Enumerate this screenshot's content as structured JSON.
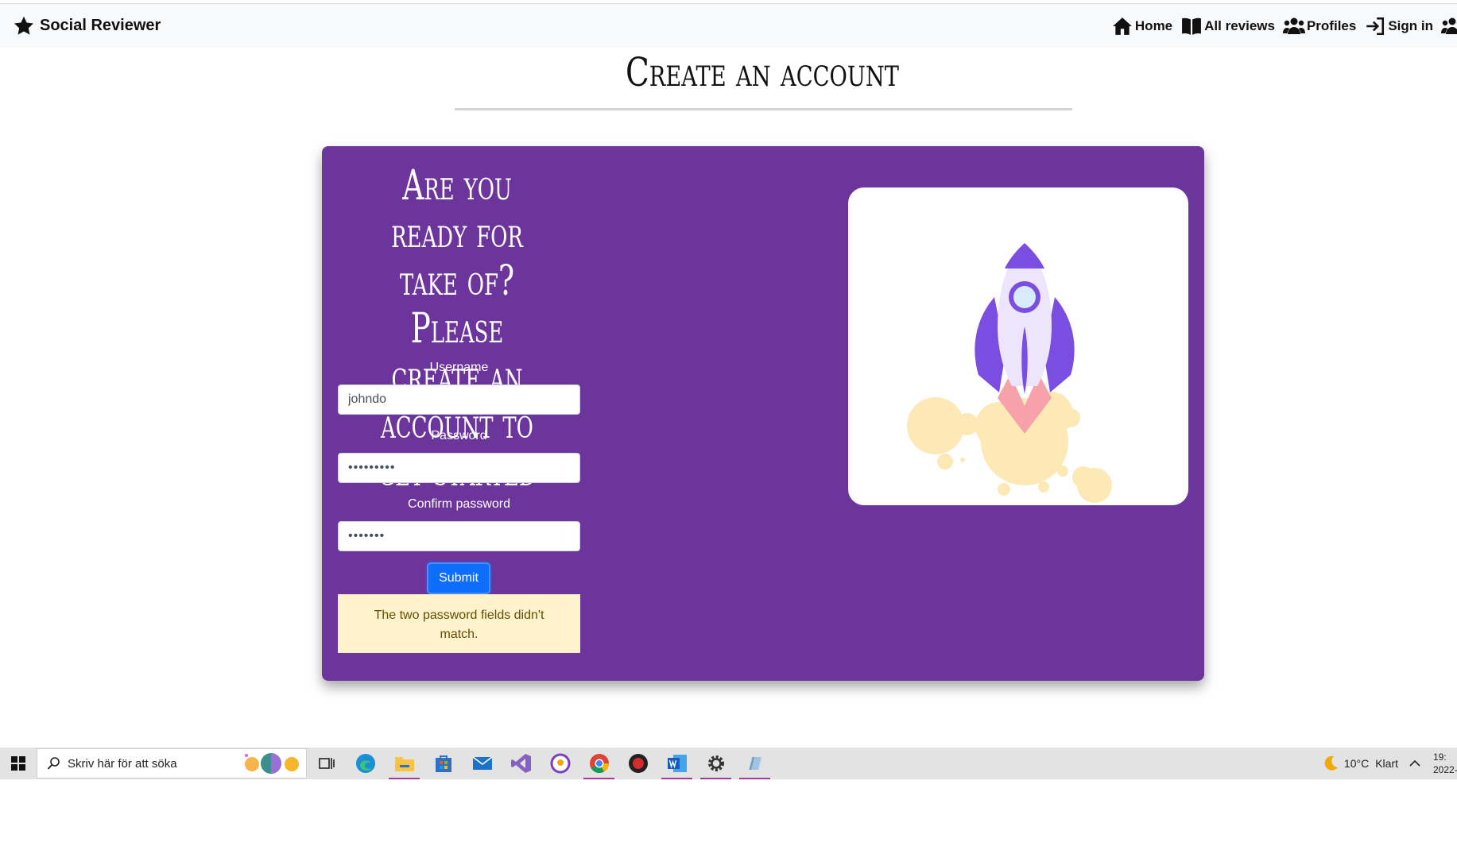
{
  "navbar": {
    "brand": "Social Reviewer",
    "items": [
      {
        "label": "Home",
        "icon": "home-icon"
      },
      {
        "label": "All reviews",
        "icon": "book-icon"
      },
      {
        "label": "Profiles",
        "icon": "users-icon"
      },
      {
        "label": "Sign in",
        "icon": "sign-in-icon"
      },
      {
        "label": "",
        "icon": "users-icon"
      }
    ]
  },
  "page": {
    "title": "Create an account"
  },
  "form": {
    "heading": "Are you ready for take of? Please create an account to get started",
    "username_label": "Username",
    "username_value": "johndo",
    "password_label": "Password",
    "password_value": "•••••••••",
    "confirm_label": "Confirm password",
    "confirm_value": "•••••••",
    "submit_label": "Submit",
    "error_message": "The two password fields didn't match."
  },
  "taskbar": {
    "search_placeholder": "Skriv här för att söka",
    "weather_temp": "10°C",
    "weather_text": "Klart",
    "clock_time": "19:",
    "clock_date": "2022-"
  },
  "colors": {
    "card": "#6b359c",
    "submit": "#0d6efd",
    "alert_bg": "#fff3cd",
    "alert_text": "#664d03"
  }
}
